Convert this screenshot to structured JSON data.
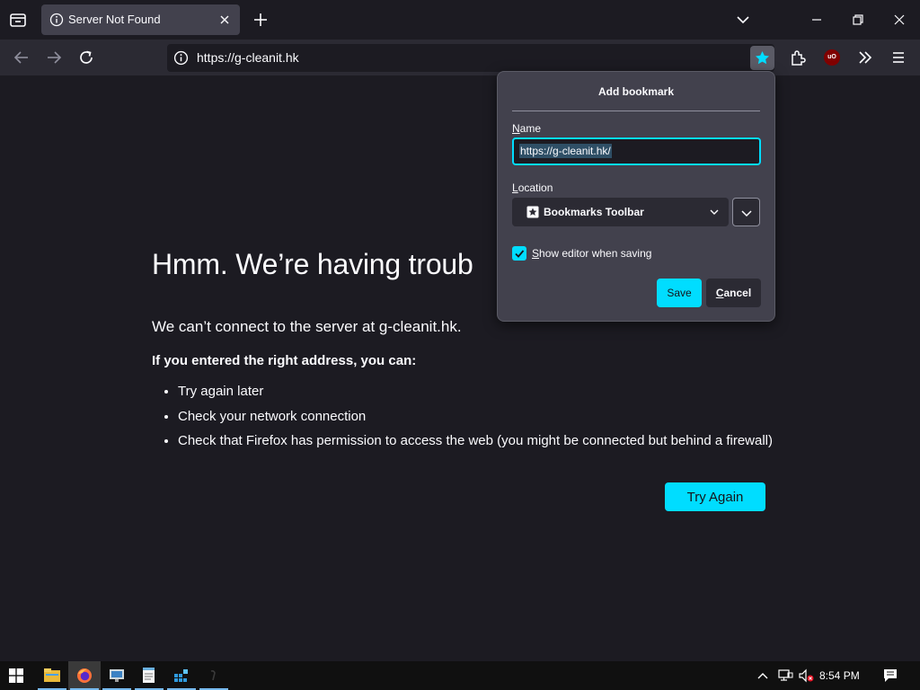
{
  "tab": {
    "title": "Server Not Found"
  },
  "urlbar": {
    "url": "https://g-cleanit.hk"
  },
  "error_page": {
    "title": "Hmm. We’re having troub",
    "description": "We can’t connect to the server at g-cleanit.hk.",
    "subtitle": "If you entered the right address, you can:",
    "suggestions": [
      "Try again later",
      "Check your network connection",
      "Check that Firefox has permission to access the web (you might be connected but behind a firewall)"
    ],
    "try_again_label": "Try Again"
  },
  "bookmark_panel": {
    "title": "Add bookmark",
    "name_label_accesskey": "N",
    "name_label_rest": "ame",
    "name_value": "https://g-cleanit.hk/",
    "location_label_accesskey": "L",
    "location_label_rest": "ocation",
    "location_value": "Bookmarks Toolbar",
    "show_editor_accesskey": "S",
    "show_editor_rest": "how editor when saving",
    "show_editor_checked": true,
    "save_label": "Save",
    "cancel_accesskey": "C",
    "cancel_rest": "ancel"
  },
  "taskbar": {
    "apps": [
      "start-icon",
      "file-explorer-icon",
      "firefox-icon",
      "network-monitor-icon",
      "notepad-icon",
      "app-grid-icon",
      "app-icon"
    ],
    "clock": "8:54 PM"
  },
  "colors": {
    "accent": "#00ddff",
    "page_bg": "#1c1b22",
    "toolbar_bg": "#2b2a33",
    "panel_bg": "#42414d"
  }
}
